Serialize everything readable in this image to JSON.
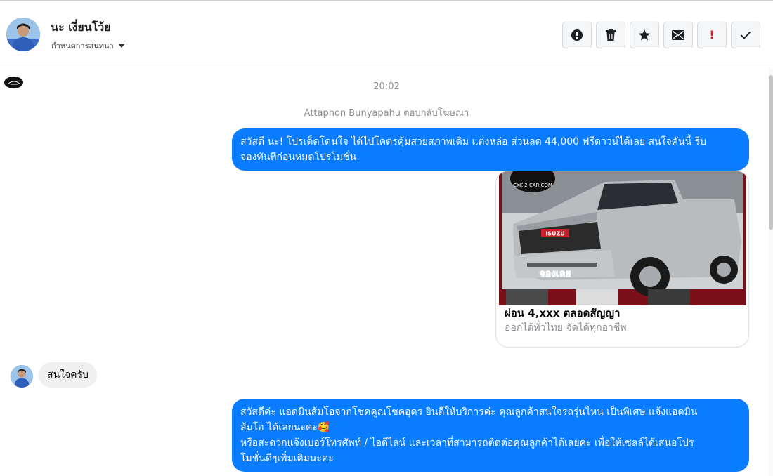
{
  "header": {
    "contact_name": "นะ เงี่ยนโว้ย",
    "conversation_settings": "กำหนดการสนทนา",
    "actions": [
      {
        "icon": "alert-circle-icon",
        "name": "report-spam-button"
      },
      {
        "icon": "trash-icon",
        "name": "delete-button"
      },
      {
        "icon": "star-icon",
        "name": "star-button"
      },
      {
        "icon": "envelope-icon",
        "name": "mark-unread-button"
      },
      {
        "icon": "exclamation-icon",
        "name": "follow-up-button",
        "color": "#e02020"
      },
      {
        "icon": "checkmark-icon",
        "name": "mark-done-button"
      }
    ]
  },
  "thread": {
    "timestamp": "20:02",
    "ad_reply_notice": "Attaphon Bunyapahu ตอบกลับโฆษณา",
    "message1": {
      "lines": [
        "สวัสดี นะ! โปรเด็ดโดนใจ ได้ไปโคตรคุ้มสวยสภาพเดิม แต่งหล่อ  ส่วนลด 44,000 ฟรีดาวน์ได้เลย  สนใจคันนี้ รีบ",
        "จองทันทีก่อนหมดโปรโมชั่น"
      ]
    },
    "ad_card": {
      "image_brand": "CKC 2 CAR.COM",
      "image_badge": "จองเลย",
      "car_badge": "ISUZU",
      "headline": "ผ่อน 4,xxx ตลอดสัญญา",
      "description": "ออกได้ทั่วไทย จัดได้ทุกอาชีพ"
    },
    "incoming_message": "สนใจครับ",
    "message2": {
      "lines": [
        "สวัสดีค่ะ แอดมินส้มโอจากโชคคูณโชคอุดร ยินดีให้บริการค่ะ   คุณลูกค้าสนใจรถรุ่นไหน เป็นพิเศษ แจ้งแอดมิน",
        "ส้มโอ ได้เลยนะคะ🥰",
        "หรือสะดวกแจ้งเบอร์โทรศัพท์ / ไอดีไลน์ และเวลาที่สามารถติดต่อคุณลูกค้าได้เลยค่ะ เพื่อให้เซลล์ได้เสนอโปร",
        "โมชั่นดีๆเพิ่มเติมนะคะ"
      ]
    }
  },
  "colors": {
    "outgoing_bubble": "#0a7cff",
    "incoming_bubble": "#f0f0f0",
    "meta_text": "#8a8d91"
  }
}
